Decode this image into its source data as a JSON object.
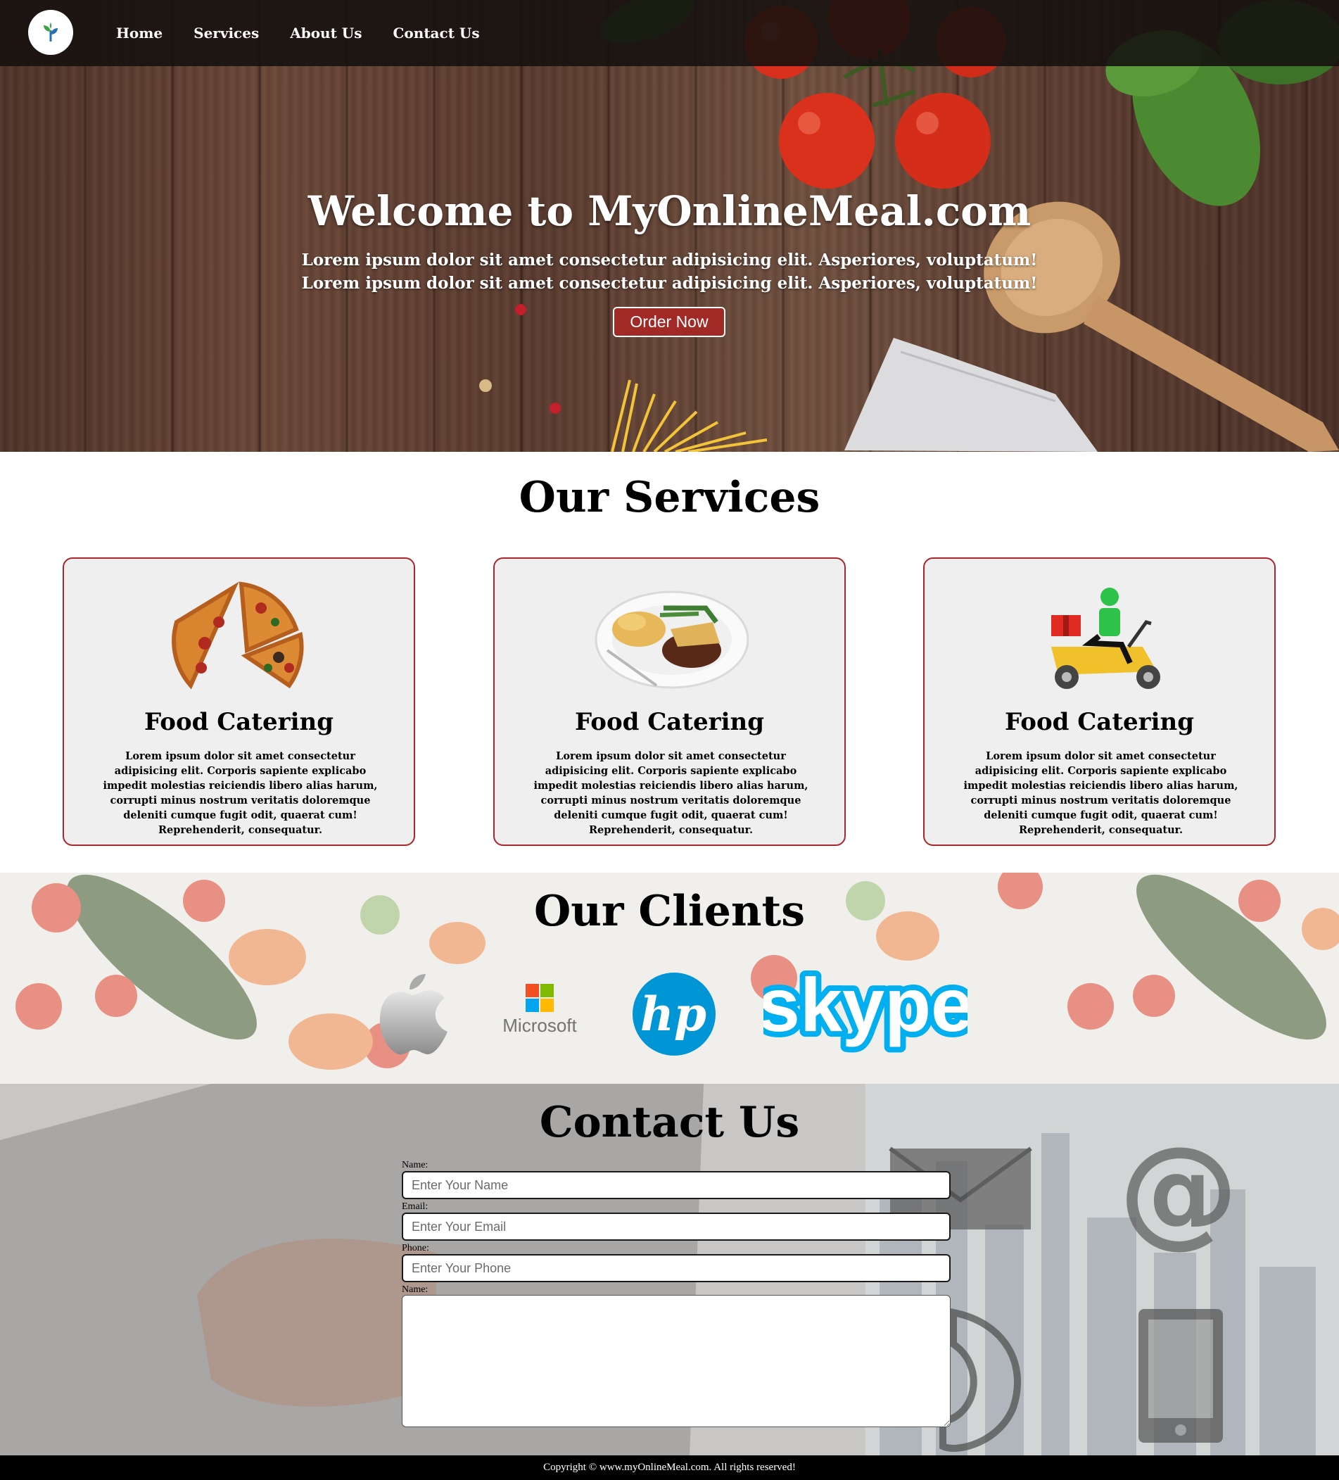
{
  "nav": {
    "logo_icon": "sprout-icon",
    "items": [
      {
        "label": "Home"
      },
      {
        "label": "Services"
      },
      {
        "label": "About Us"
      },
      {
        "label": "Contact Us"
      }
    ]
  },
  "hero": {
    "title": "Welcome to MyOnlineMeal.com",
    "subtitle_line1": "Lorem ipsum dolor sit amet consectetur adipisicing elit. Asperiores, voluptatum!",
    "subtitle_line2": "Lorem ipsum dolor sit amet consectetur adipisicing elit. Asperiores, voluptatum!",
    "button_label": "Order Now"
  },
  "services": {
    "title": "Our Services",
    "cards": [
      {
        "image": "pizza-slices-image",
        "title": "Food Catering",
        "text": "Lorem ipsum dolor sit amet consectetur adipisicing elit. Corporis sapiente explicabo impedit molestias reiciendis libero alias harum, corrupti minus nostrum veritatis doloremque deleniti cumque fugit odit, quaerat cum! Reprehenderit, consequatur."
      },
      {
        "image": "meal-plate-image",
        "title": "Food Catering",
        "text": "Lorem ipsum dolor sit amet consectetur adipisicing elit. Corporis sapiente explicabo impedit molestias reiciendis libero alias harum, corrupti minus nostrum veritatis doloremque deleniti cumque fugit odit, quaerat cum! Reprehenderit, consequatur."
      },
      {
        "image": "delivery-scooter-image",
        "title": "Food Catering",
        "text": "Lorem ipsum dolor sit amet consectetur adipisicing elit. Corporis sapiente explicabo impedit molestias reiciendis libero alias harum, corrupti minus nostrum veritatis doloremque deleniti cumque fugit odit, quaerat cum! Reprehenderit, consequatur."
      }
    ]
  },
  "clients": {
    "title": "Our Clients",
    "logos": [
      {
        "name": "apple-logo"
      },
      {
        "name": "microsoft-logo",
        "text": "Microsoft"
      },
      {
        "name": "hp-logo",
        "text": "hp"
      },
      {
        "name": "skype-logo",
        "text": "skype"
      }
    ]
  },
  "contact": {
    "title": "Contact Us",
    "name_label": "Name:",
    "name_placeholder": "Enter Your Name",
    "email_label": "Email:",
    "email_placeholder": "Enter Your Email",
    "phone_label": "Phone:",
    "phone_placeholder": "Enter Your Phone",
    "message_label": "Name:"
  },
  "footer": {
    "text": "Copyright © www.myOnlineMeal.com. All rights reserved!"
  },
  "colors": {
    "accent": "#a22a26",
    "nav_bg": "#14100e",
    "card_bg": "#efefef",
    "footer_bg": "#000000"
  }
}
